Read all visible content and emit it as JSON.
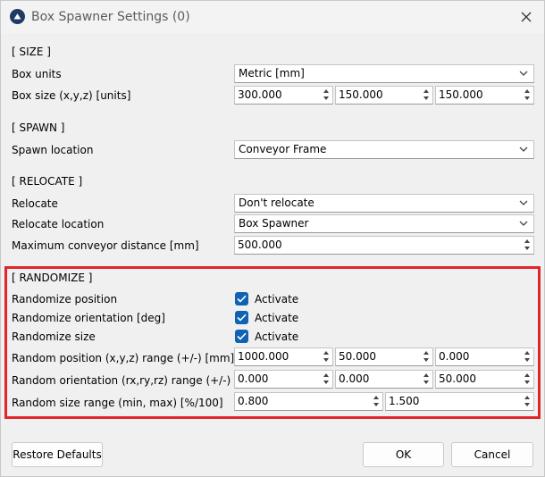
{
  "window": {
    "title": "Box Spawner Settings (0)"
  },
  "sections": {
    "size": "[ SIZE ]",
    "spawn": "[ SPAWN ]",
    "relocate": "[ RELOCATE ]",
    "randomize": "[ RANDOMIZE ]"
  },
  "size": {
    "box_units_label": "Box units",
    "box_units_value": "Metric [mm]",
    "box_size_label": "Box size (x,y,z) [units]",
    "box_size_x": "300.000",
    "box_size_y": "150.000",
    "box_size_z": "150.000"
  },
  "spawn": {
    "location_label": "Spawn location",
    "location_value": "Conveyor Frame"
  },
  "relocate": {
    "relocate_label": "Relocate",
    "relocate_value": "Don't relocate",
    "location_label": "Relocate location",
    "location_value": "Box Spawner",
    "max_distance_label": "Maximum conveyor distance [mm]",
    "max_distance_value": "500.000"
  },
  "randomize": {
    "position_label": "Randomize position",
    "orientation_label": "Randomize orientation [deg]",
    "size_label": "Randomize size",
    "activate_label": "Activate",
    "position_checked": true,
    "orientation_checked": true,
    "size_checked": true,
    "pos_range_label": "Random position (x,y,z) range (+/-) [mm]",
    "pos_range_x": "1000.000",
    "pos_range_y": "50.000",
    "pos_range_z": "0.000",
    "orient_range_label": "Random orientation (rx,ry,rz) range (+/-)",
    "orient_range_rx": "0.000",
    "orient_range_ry": "0.000",
    "orient_range_rz": "50.000",
    "size_range_label": "Random size range (min, max) [%/100]",
    "size_range_min": "0.800",
    "size_range_max": "1.500"
  },
  "buttons": {
    "restore_defaults": "Restore Defaults",
    "ok": "OK",
    "cancel": "Cancel"
  },
  "colors": {
    "highlight_border": "#e0262b",
    "checkbox_fill": "#0f62b4"
  }
}
